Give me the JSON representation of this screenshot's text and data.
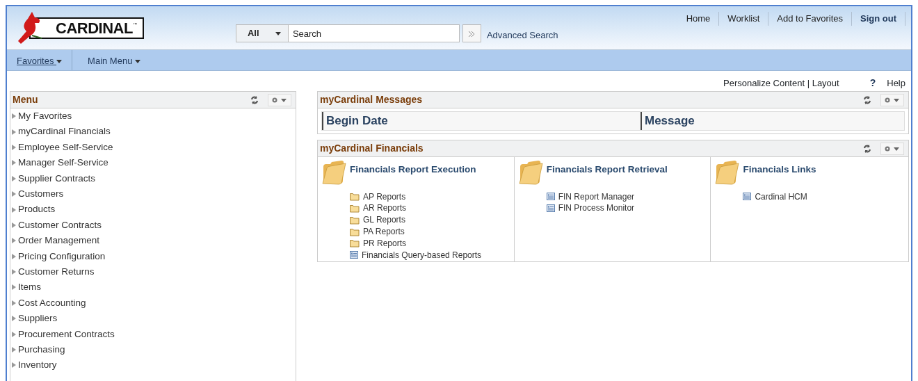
{
  "header": {
    "logo": {
      "text": "CARDINAL",
      "mark": "™"
    },
    "search": {
      "scope": "All",
      "placeholder": "Search",
      "advanced": "Advanced Search"
    },
    "links": [
      "Home",
      "Worklist",
      "Add to Favorites"
    ],
    "sign_out": "Sign out"
  },
  "nav": [
    {
      "label": "Favorites",
      "focused": true
    },
    {
      "label": "Main Menu",
      "focused": false
    }
  ],
  "toolbar": {
    "personalize": "Personalize Content | Layout",
    "help_icon": "?",
    "help": "Help"
  },
  "menu": {
    "title": "Menu",
    "items": [
      {
        "label": "My Favorites",
        "expanded": false
      },
      {
        "label": "myCardinal Financials",
        "expanded": false
      },
      {
        "label": "Employee Self-Service",
        "expanded": false
      },
      {
        "label": "Manager Self-Service",
        "expanded": false
      },
      {
        "label": "Supplier Contracts",
        "expanded": false
      },
      {
        "label": "Customers",
        "expanded": false
      },
      {
        "label": "Products",
        "expanded": false
      },
      {
        "label": "Customer Contracts",
        "expanded": false
      },
      {
        "label": "Order Management",
        "expanded": false
      },
      {
        "label": "Pricing Configuration",
        "expanded": false
      },
      {
        "label": "Customer Returns",
        "expanded": false
      },
      {
        "label": "Items",
        "expanded": false
      },
      {
        "label": "Cost Accounting",
        "expanded": false
      },
      {
        "label": "Suppliers",
        "expanded": false
      },
      {
        "label": "Procurement Contracts",
        "expanded": false
      },
      {
        "label": "Purchasing",
        "expanded": false
      },
      {
        "label": "Inventory",
        "expanded": false
      }
    ]
  },
  "messages": {
    "title": "myCardinal Messages",
    "columns": [
      "Begin Date",
      "Message"
    ]
  },
  "financials": {
    "title": "myCardinal Financials",
    "sections": [
      {
        "title": "Financials Report Execution",
        "items": [
          {
            "label": "AP Reports",
            "kind": "folder"
          },
          {
            "label": "AR Reports",
            "kind": "folder"
          },
          {
            "label": "GL Reports",
            "kind": "folder"
          },
          {
            "label": "PA Reports",
            "kind": "folder"
          },
          {
            "label": "PR Reports",
            "kind": "folder"
          },
          {
            "label": "Financials Query-based Reports",
            "kind": "page"
          }
        ]
      },
      {
        "title": "Financials Report Retrieval",
        "items": [
          {
            "label": "FIN Report Manager",
            "kind": "page"
          },
          {
            "label": "FIN Process Monitor",
            "kind": "page"
          }
        ]
      },
      {
        "title": "Financials Links",
        "items": [
          {
            "label": "Cardinal HCM",
            "kind": "page"
          }
        ]
      }
    ]
  }
}
